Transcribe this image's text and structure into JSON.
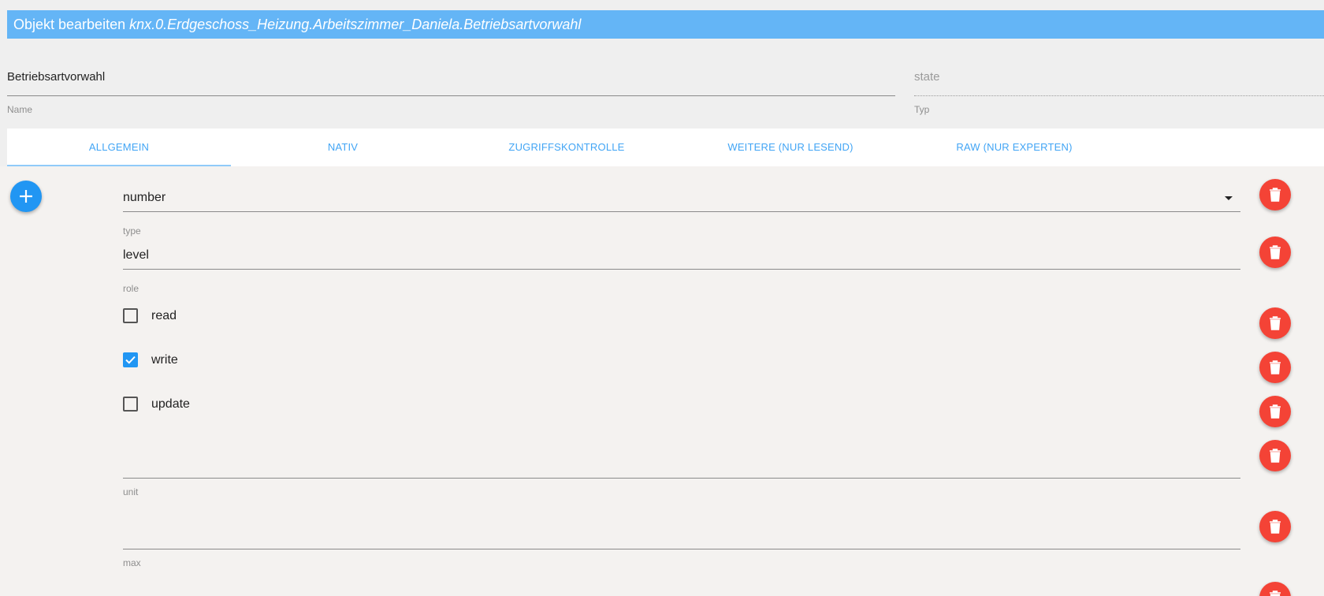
{
  "title": {
    "prefix": "Objekt bearbeiten",
    "object_id": "knx.0.Erdgeschoss_Heizung.Arbeitszimmer_Daniela.Betriebsartvorwahl"
  },
  "name_field": {
    "value": "Betriebsartvorwahl",
    "label": "Name"
  },
  "type_field": {
    "value": "state",
    "label": "Typ"
  },
  "tabs": [
    {
      "label": "ALLGEMEIN",
      "active": true
    },
    {
      "label": "NATIV",
      "active": false
    },
    {
      "label": "ZUGRIFFSKONTROLLE",
      "active": false
    },
    {
      "label": "WEITERE (NUR LESEND)",
      "active": false
    },
    {
      "label": "RAW (NUR EXPERTEN)",
      "active": false
    }
  ],
  "common": {
    "type": {
      "value": "number",
      "label": "type"
    },
    "role": {
      "value": "level",
      "label": "role"
    },
    "read": {
      "label": "read",
      "checked": false
    },
    "write": {
      "label": "write",
      "checked": true
    },
    "update": {
      "label": "update",
      "checked": false
    },
    "unit": {
      "value": "",
      "label": "unit"
    },
    "max": {
      "value": "",
      "label": "max"
    }
  },
  "colors": {
    "accent": "#2196f3",
    "title_bar": "#64b5f6",
    "delete": "#f44336"
  },
  "icons": {
    "add": "plus-icon",
    "delete": "trash-icon",
    "dropdown": "caret-down-icon",
    "check": "check-icon"
  }
}
